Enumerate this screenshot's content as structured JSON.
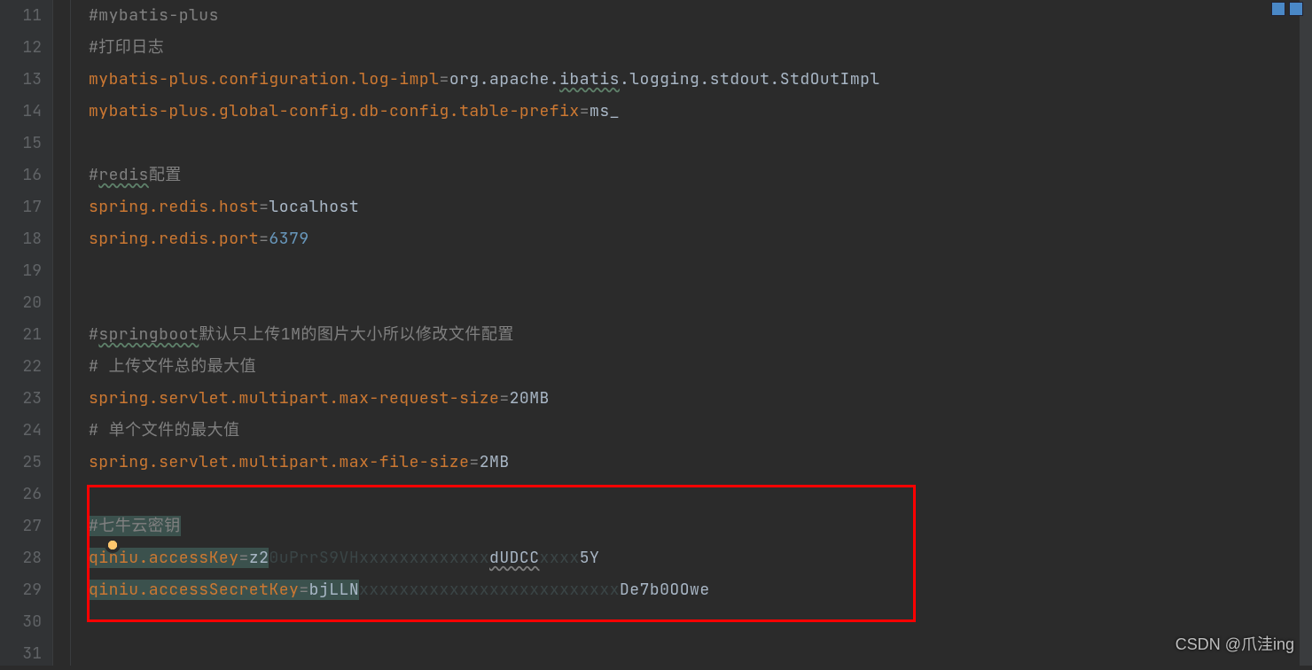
{
  "gutter": {
    "start": 11,
    "end": 31
  },
  "lines": {
    "l11": {
      "type": "comment",
      "text": "#mybatis-plus"
    },
    "l12": {
      "type": "comment",
      "text": "#打印日志"
    },
    "l13": {
      "key": "mybatis-plus.configuration.log-impl",
      "eq": "=",
      "val_pre": "org.apache.",
      "val_squig": "ibatis",
      "val_post": ".logging.stdout.StdOutImpl"
    },
    "l14": {
      "key": "mybatis-plus.global-config.db-config.table-prefix",
      "eq": "=",
      "val": "ms_"
    },
    "l16": {
      "type": "comment",
      "pre": "#",
      "sq": "redis",
      "post": "配置"
    },
    "l17": {
      "key": "spring.redis.host",
      "eq": "=",
      "val": "localhost"
    },
    "l18": {
      "key": "spring.redis.port",
      "eq": "=",
      "val": "6379"
    },
    "l21": {
      "type": "comment",
      "pre": "#",
      "sq": "springboot",
      "post": "默认只上传1M的图片大小所以修改文件配置"
    },
    "l22": {
      "type": "comment",
      "text": "# 上传文件总的最大值"
    },
    "l23": {
      "key": "spring.servlet.multipart.max-request-size",
      "eq": "=",
      "val": "20MB"
    },
    "l24": {
      "type": "comment",
      "text": "# 单个文件的最大值"
    },
    "l25": {
      "key": "spring.servlet.multipart.max-file-size",
      "eq": "=",
      "val": "2MB"
    },
    "l27": {
      "type": "comment",
      "text": "#七牛云密钥"
    },
    "l28": {
      "key": "qiniu.accessKey",
      "eq": "=",
      "v1": "z2",
      "vs1": "0uPrrS9VH",
      "vs2": "xxxxxxxxxxxxx",
      "v2": "dUDCC",
      "vs3": "xxxx",
      "v3": "5Y"
    },
    "l29": {
      "key": "qiniu.accessSecretKey",
      "eq": "=",
      "v1": "bjLLN",
      "vs1": "xxxxxxxxxxxxxxxxxxxxxxxxxx",
      "v2": "De7b0OOwe"
    }
  },
  "watermark": "CSDN @爪洼ing"
}
